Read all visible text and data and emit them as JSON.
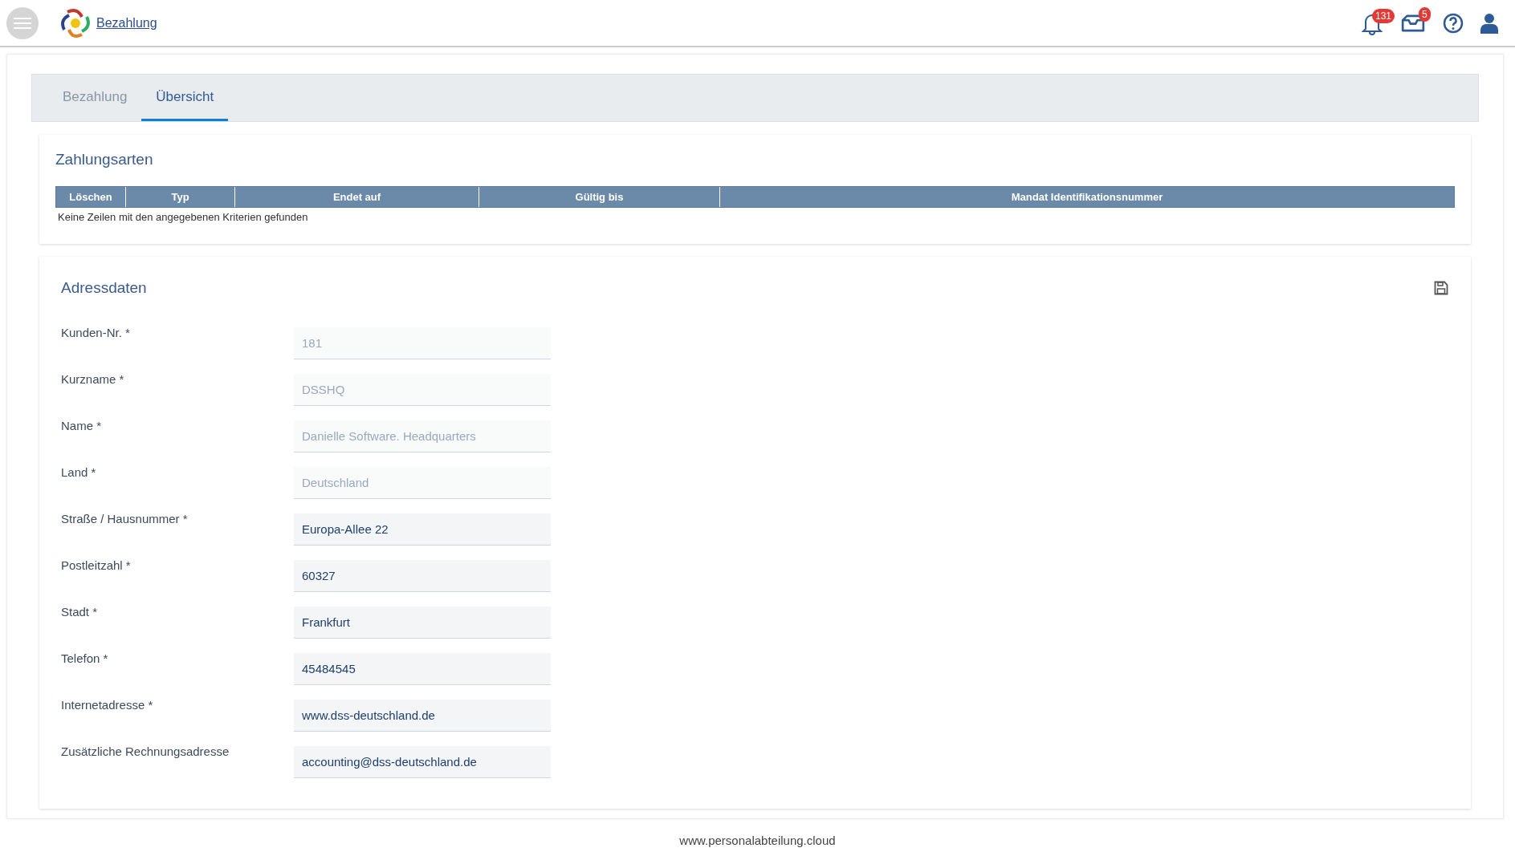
{
  "header": {
    "title": "Bezahlung",
    "notifications_badge": "131",
    "messages_badge": "5"
  },
  "tabs": [
    {
      "label": "Bezahlung",
      "selected": false
    },
    {
      "label": "Übersicht",
      "selected": true
    }
  ],
  "payment_methods": {
    "title": "Zahlungsarten",
    "columns": [
      "Löschen",
      "Typ",
      "Endet auf",
      "Gültig bis",
      "Mandat Identifikationsnummer"
    ],
    "empty_message": "Keine Zeilen mit den angegebenen Kriterien gefunden"
  },
  "address": {
    "title": "Adressdaten",
    "fields": [
      {
        "label": "Kunden-Nr. *",
        "value": "181",
        "disabled": true
      },
      {
        "label": "Kurzname *",
        "value": "DSSHQ",
        "disabled": true
      },
      {
        "label": "Name *",
        "value": "Danielle Software. Headquarters",
        "disabled": true
      },
      {
        "label": "Land *",
        "value": "Deutschland",
        "disabled": true
      },
      {
        "label": "Straße / Hausnummer *",
        "value": "Europa-Allee 22",
        "disabled": false
      },
      {
        "label": "Postleitzahl *",
        "value": "60327",
        "disabled": false
      },
      {
        "label": "Stadt *",
        "value": "Frankfurt",
        "disabled": false
      },
      {
        "label": "Telefon *",
        "value": "45484545",
        "disabled": false
      },
      {
        "label": "Internetadresse *",
        "value": "www.dss-deutschland.de",
        "disabled": false
      },
      {
        "label": "Zusätzliche Rechnungsadresse",
        "value": "accounting@dss-deutschland.de",
        "disabled": false
      }
    ]
  },
  "footer": "www.personalabteilung.cloud"
}
